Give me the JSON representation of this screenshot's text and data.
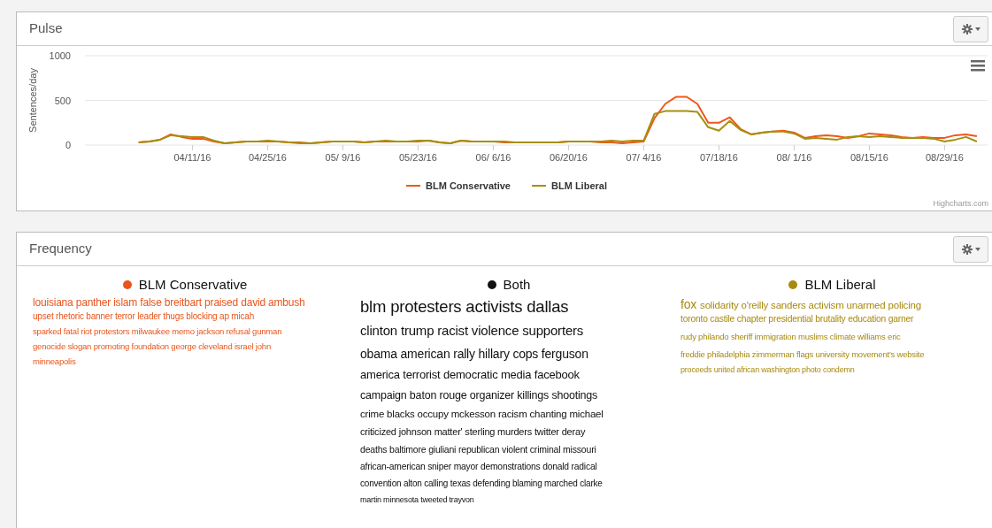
{
  "pulse": {
    "title": "Pulse",
    "credit": "Highcharts.com",
    "chart_data": {
      "type": "line",
      "ylabel": "Sentences/day",
      "ylim": [
        0,
        1000
      ],
      "yticks": [
        0,
        500,
        1000
      ],
      "legend": "bottom",
      "categories": [
        null,
        null,
        null,
        null,
        null,
        "04/11/16",
        null,
        null,
        null,
        null,
        null,
        null,
        "04/25/16",
        null,
        null,
        null,
        null,
        null,
        null,
        "05/ 9/16",
        null,
        null,
        null,
        null,
        null,
        null,
        "05/23/16",
        null,
        null,
        null,
        null,
        null,
        null,
        "06/ 6/16",
        null,
        null,
        null,
        null,
        null,
        null,
        "06/20/16",
        null,
        null,
        null,
        null,
        null,
        null,
        "07/ 4/16",
        null,
        null,
        null,
        null,
        null,
        null,
        "07/18/16",
        null,
        null,
        null,
        null,
        null,
        null,
        "08/ 1/16",
        null,
        null,
        null,
        null,
        null,
        null,
        "08/15/16",
        null,
        null,
        null,
        null,
        null,
        null,
        "08/29/16",
        null,
        null,
        null
      ],
      "series": [
        {
          "name": "BLM Conservative",
          "color": "#f0561c",
          "values": [
            30,
            40,
            60,
            120,
            90,
            70,
            70,
            40,
            20,
            30,
            40,
            40,
            40,
            40,
            30,
            30,
            20,
            30,
            40,
            40,
            40,
            30,
            40,
            40,
            40,
            40,
            40,
            50,
            30,
            20,
            50,
            40,
            40,
            40,
            30,
            30,
            30,
            30,
            30,
            30,
            40,
            40,
            40,
            30,
            30,
            20,
            30,
            40,
            300,
            460,
            540,
            540,
            460,
            250,
            250,
            310,
            180,
            120,
            140,
            150,
            160,
            140,
            80,
            100,
            110,
            100,
            80,
            100,
            130,
            120,
            110,
            90,
            80,
            90,
            80,
            80,
            110,
            120,
            100
          ]
        },
        {
          "name": "BLM Liberal",
          "color": "#a5900e",
          "values": [
            30,
            40,
            60,
            110,
            100,
            90,
            90,
            50,
            20,
            30,
            40,
            40,
            50,
            40,
            30,
            20,
            20,
            30,
            40,
            40,
            40,
            30,
            40,
            50,
            40,
            40,
            50,
            50,
            30,
            20,
            50,
            40,
            40,
            40,
            40,
            30,
            30,
            30,
            30,
            30,
            40,
            40,
            40,
            40,
            50,
            40,
            50,
            50,
            350,
            380,
            380,
            380,
            370,
            200,
            160,
            270,
            170,
            120,
            140,
            150,
            150,
            130,
            70,
            80,
            70,
            60,
            90,
            100,
            90,
            100,
            90,
            80,
            80,
            80,
            70,
            40,
            60,
            90,
            40
          ]
        }
      ]
    }
  },
  "frequency": {
    "title": "Frequency",
    "groups": [
      {
        "name": "BLM Conservative",
        "color": "#e8561c",
        "lines": [
          [
            "louisiana panther islam false breitbart praised david ambush"
          ],
          [
            "upset rhetoric banner terror leader thugs blocking ap micah"
          ],
          [
            "sparked fatal riot protestors milwaukee memo jackson refusal gunman"
          ],
          [
            "genocide slogan promoting foundation george cleveland israel john"
          ],
          [
            "minneapolis"
          ]
        ]
      },
      {
        "name": "Both",
        "color": "#111111",
        "lines": [
          [
            "blm protesters activists dallas"
          ],
          [
            "clinton trump racist violence supporters"
          ],
          [
            "obama american rally hillary cops ferguson"
          ],
          [
            "america terrorist democratic media facebook"
          ],
          [
            "campaign baton rouge organizer killings shootings"
          ],
          [
            "crime blacks occupy mckesson racism chanting michael"
          ],
          [
            "criticized johnson matter' sterling murders twitter deray"
          ],
          [
            "deaths baltimore giuliani republican violent criminal missouri"
          ],
          [
            "african-american sniper mayor demonstrations donald radical"
          ],
          [
            "convention alton calling texas defending blaming marched clarke"
          ],
          [
            "martin minnesota tweeted trayvon"
          ]
        ]
      },
      {
        "name": "BLM Liberal",
        "color": "#a88a10",
        "lines": [
          [
            "fox",
            "solidarity o'reilly sanders activism unarmed policing"
          ],
          [
            "toronto castile chapter presidential brutality education garner"
          ],
          [
            "rudy philando sheriff immigration muslims climate williams eric"
          ],
          [
            "freddie philadelphia zimmerman flags university movement's website"
          ],
          [
            "proceeds united african washington photo condemn"
          ]
        ]
      }
    ]
  }
}
